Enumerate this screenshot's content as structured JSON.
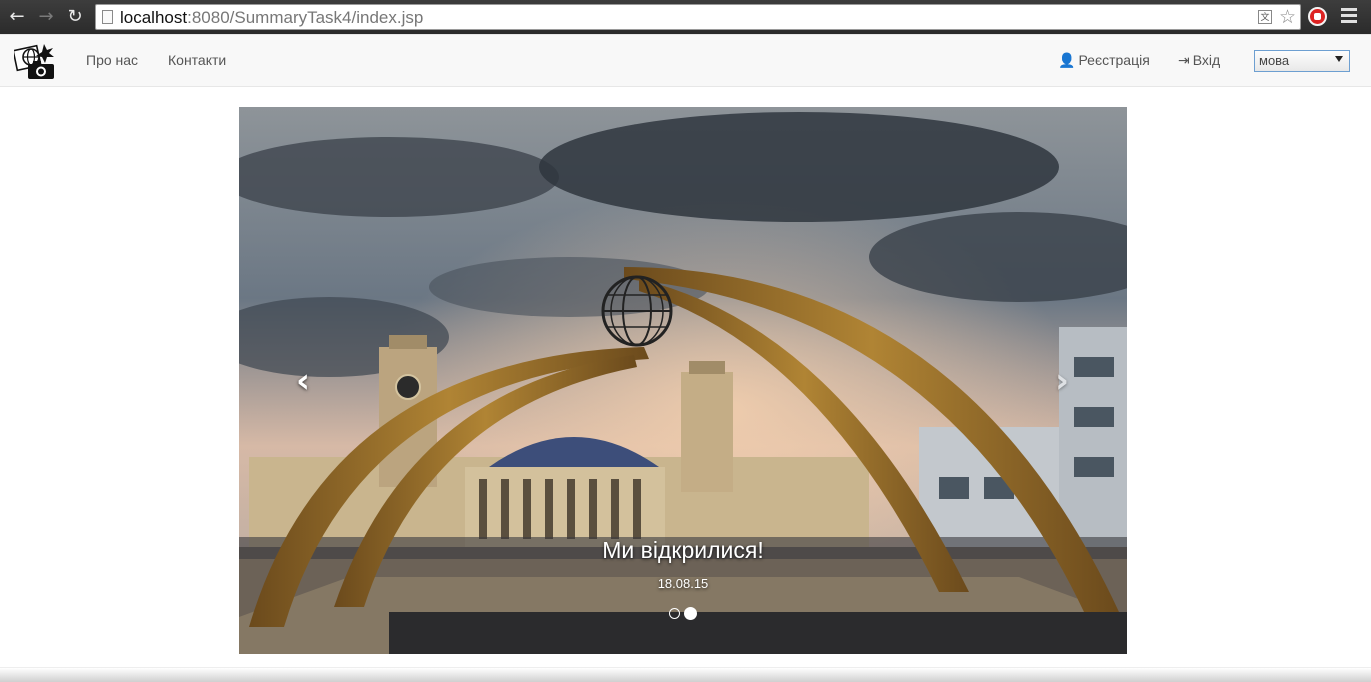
{
  "browser": {
    "back_glyph": "←",
    "forward_glyph": "→",
    "reload_glyph": "↻",
    "url_host": "localhost",
    "url_rest": ":8080/SummaryTask4/index.jsp",
    "star_glyph": "☆",
    "translate_glyph": "文"
  },
  "navbar": {
    "links": [
      {
        "label": "Про нас"
      },
      {
        "label": "Контакти"
      }
    ],
    "register": {
      "icon": "user-icon",
      "glyph": "👤",
      "label": "Реєстрація"
    },
    "login": {
      "icon": "login-icon",
      "glyph": "⇥",
      "label": "Вхід"
    },
    "language_select": {
      "value": "мова"
    }
  },
  "carousel": {
    "prev_glyph": "‹",
    "next_glyph": "›",
    "caption_title": "Ми відкрилися!",
    "caption_date": "18.08.15",
    "slide_count": 2,
    "active_slide": 2
  },
  "colors": {
    "navbar_bg": "#f8f8f8",
    "link": "#555555",
    "select_border": "#6d9fd1"
  }
}
